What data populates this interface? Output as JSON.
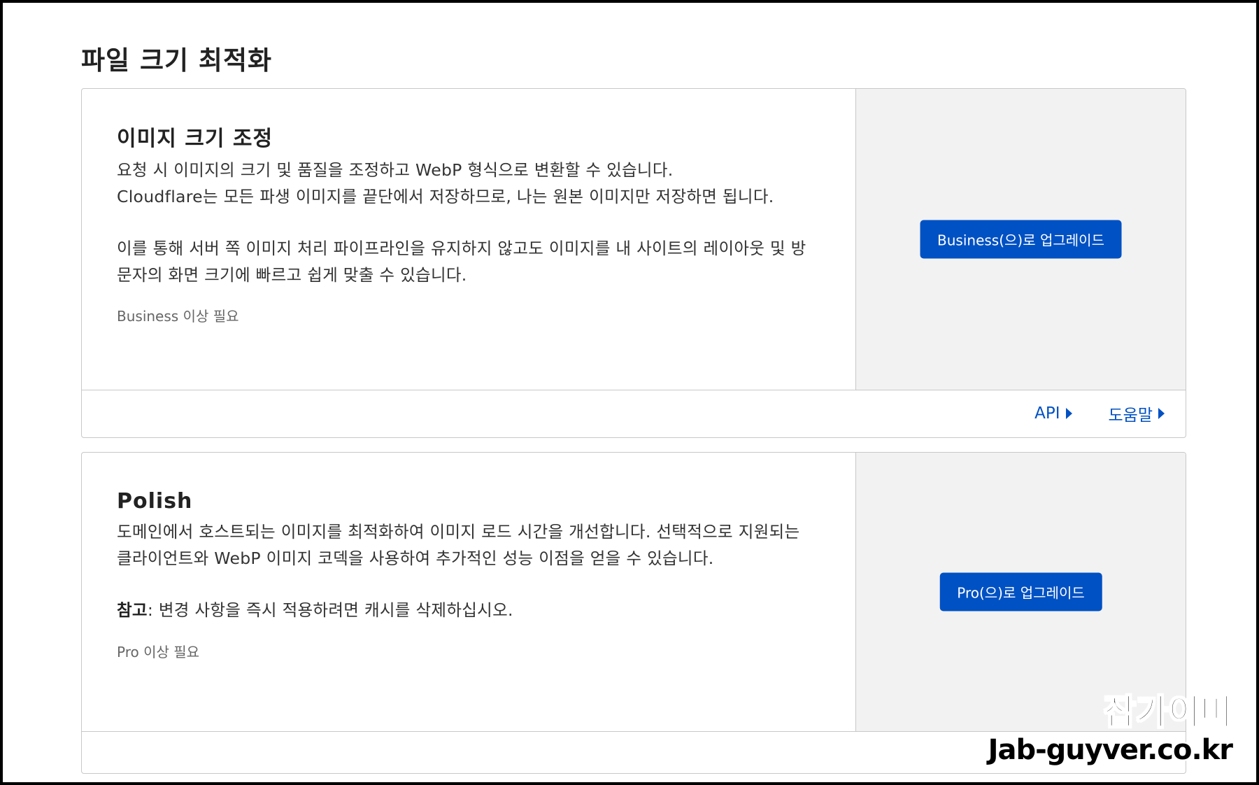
{
  "page": {
    "title": "파일 크기 최적화"
  },
  "cards": [
    {
      "title": "이미지 크기 조정",
      "description": [
        "요청 시 이미지의 크기 및 품질을 조정하고 WebP 형식으로 변환할 수 있습니다.",
        "Cloudflare는 모든 파생 이미지를 끝단에서 저장하므로, 나는 원본 이미지만 저장하면 됩니다.",
        "이를 통해 서버 쪽 이미지 처리 파이프라인을 유지하지 않고도 이미지를 내 사이트의 레이아웃 및 방문자의 화면 크기에 빠르고 쉽게 맞출 수 있습니다."
      ],
      "requirement": "Business 이상 필요",
      "upgrade_label": "Business(으)로 업그레이드",
      "footer_links": [
        {
          "label": "API"
        },
        {
          "label": "도움말"
        }
      ]
    },
    {
      "title": "Polish",
      "description": [
        "도메인에서 호스트되는 이미지를 최적화하여 이미지 로드 시간을 개선합니다. 선택적으로 지원되는 클라이언트와 WebP 이미지 코덱을 사용하여 추가적인 성능 이점을 얻을 수 있습니다."
      ],
      "note_label": "참고",
      "note_text": ": 변경 사항을 즉시 적용하려면 캐시를 삭제하십시오.",
      "requirement": "Pro 이상 필요",
      "upgrade_label": "Pro(으)로 업그레이드"
    }
  ],
  "watermark": {
    "line1": "잡가이버",
    "line2": "Jab-guyver.co.kr"
  },
  "colors": {
    "accent": "#0051c3",
    "side_panel": "#f2f2f2",
    "border": "#c8c8c8"
  }
}
